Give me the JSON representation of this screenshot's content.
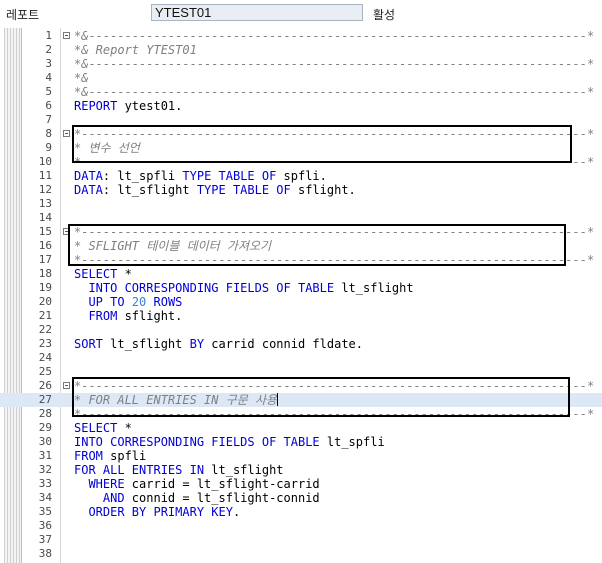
{
  "header": {
    "program_label": "레포트",
    "program_name": "YTEST01",
    "status": "활성"
  },
  "lines": [
    {
      "n": "1",
      "fold": true,
      "parts": [
        {
          "t": "*&---------------------------------------------------------------------*",
          "c": "cmt"
        }
      ]
    },
    {
      "n": "2",
      "fold": false,
      "parts": [
        {
          "t": "*& Report YTEST01",
          "c": "cmt"
        }
      ]
    },
    {
      "n": "3",
      "fold": false,
      "parts": [
        {
          "t": "*&---------------------------------------------------------------------*",
          "c": "cmt"
        }
      ]
    },
    {
      "n": "4",
      "fold": false,
      "parts": [
        {
          "t": "*&",
          "c": "cmt"
        }
      ]
    },
    {
      "n": "5",
      "fold": false,
      "parts": [
        {
          "t": "*&---------------------------------------------------------------------*",
          "c": "cmt"
        }
      ]
    },
    {
      "n": "6",
      "fold": false,
      "parts": [
        {
          "t": "REPORT",
          "c": "kw"
        },
        {
          "t": " ytest01.",
          "c": ""
        }
      ]
    },
    {
      "n": "7",
      "fold": false,
      "parts": []
    },
    {
      "n": "8",
      "fold": true,
      "parts": [
        {
          "t": "*----------------------------------------------------------------------*",
          "c": "cmt"
        }
      ]
    },
    {
      "n": "9",
      "fold": false,
      "parts": [
        {
          "t": "* 변수 선언",
          "c": "cmt"
        }
      ]
    },
    {
      "n": "10",
      "fold": false,
      "parts": [
        {
          "t": "*----------------------------------------------------------------------*",
          "c": "cmt"
        }
      ]
    },
    {
      "n": "11",
      "fold": false,
      "parts": [
        {
          "t": "DATA",
          "c": "kw"
        },
        {
          "t": ": lt_spfli ",
          "c": ""
        },
        {
          "t": "TYPE TABLE OF",
          "c": "kw"
        },
        {
          "t": " spfli.",
          "c": ""
        }
      ]
    },
    {
      "n": "12",
      "fold": false,
      "parts": [
        {
          "t": "DATA",
          "c": "kw"
        },
        {
          "t": ": lt_sflight ",
          "c": ""
        },
        {
          "t": "TYPE TABLE OF",
          "c": "kw"
        },
        {
          "t": " sflight.",
          "c": ""
        }
      ]
    },
    {
      "n": "13",
      "fold": false,
      "parts": []
    },
    {
      "n": "14",
      "fold": false,
      "parts": []
    },
    {
      "n": "15",
      "fold": true,
      "parts": [
        {
          "t": "*----------------------------------------------------------------------*",
          "c": "cmt"
        }
      ]
    },
    {
      "n": "16",
      "fold": false,
      "parts": [
        {
          "t": "* SFLIGHT 테이블 데이터 가져오기",
          "c": "cmt"
        }
      ]
    },
    {
      "n": "17",
      "fold": false,
      "parts": [
        {
          "t": "*----------------------------------------------------------------------*",
          "c": "cmt"
        }
      ]
    },
    {
      "n": "18",
      "fold": false,
      "parts": [
        {
          "t": "SELECT",
          "c": "kw"
        },
        {
          "t": " *",
          "c": ""
        }
      ]
    },
    {
      "n": "19",
      "fold": false,
      "parts": [
        {
          "t": "  INTO CORRESPONDING FIELDS OF TABLE",
          "c": "kw"
        },
        {
          "t": " lt_sflight",
          "c": ""
        }
      ]
    },
    {
      "n": "20",
      "fold": false,
      "parts": [
        {
          "t": "  UP TO",
          "c": "kw"
        },
        {
          "t": " ",
          "c": ""
        },
        {
          "t": "20",
          "c": "num"
        },
        {
          "t": " ",
          "c": ""
        },
        {
          "t": "ROWS",
          "c": "kw"
        }
      ]
    },
    {
      "n": "21",
      "fold": false,
      "parts": [
        {
          "t": "  FROM",
          "c": "kw"
        },
        {
          "t": " sflight.",
          "c": ""
        }
      ]
    },
    {
      "n": "22",
      "fold": false,
      "parts": []
    },
    {
      "n": "23",
      "fold": false,
      "parts": [
        {
          "t": "SORT",
          "c": "kw"
        },
        {
          "t": " lt_sflight ",
          "c": ""
        },
        {
          "t": "BY",
          "c": "kw"
        },
        {
          "t": " carrid connid fldate.",
          "c": ""
        }
      ]
    },
    {
      "n": "24",
      "fold": false,
      "parts": []
    },
    {
      "n": "25",
      "fold": false,
      "parts": []
    },
    {
      "n": "26",
      "fold": true,
      "parts": [
        {
          "t": "*----------------------------------------------------------------------*",
          "c": "cmt"
        }
      ]
    },
    {
      "n": "27",
      "fold": false,
      "hl": true,
      "caret": true,
      "parts": [
        {
          "t": "* FOR ALL ENTRIES IN 구문 사용",
          "c": "cmt"
        }
      ]
    },
    {
      "n": "28",
      "fold": false,
      "parts": [
        {
          "t": "*----------------------------------------------------------------------*",
          "c": "cmt"
        }
      ]
    },
    {
      "n": "29",
      "fold": false,
      "parts": [
        {
          "t": "SELECT",
          "c": "kw"
        },
        {
          "t": " *",
          "c": ""
        }
      ]
    },
    {
      "n": "30",
      "fold": false,
      "parts": [
        {
          "t": "INTO CORRESPONDING FIELDS OF TABLE",
          "c": "kw"
        },
        {
          "t": " lt_spfli",
          "c": ""
        }
      ]
    },
    {
      "n": "31",
      "fold": false,
      "parts": [
        {
          "t": "FROM",
          "c": "kw"
        },
        {
          "t": " spfli",
          "c": ""
        }
      ]
    },
    {
      "n": "32",
      "fold": false,
      "parts": [
        {
          "t": "FOR ALL ENTRIES IN",
          "c": "kw"
        },
        {
          "t": " lt_sflight",
          "c": ""
        }
      ]
    },
    {
      "n": "33",
      "fold": false,
      "parts": [
        {
          "t": "  WHERE",
          "c": "kw"
        },
        {
          "t": " carrid = lt_sflight-carrid",
          "c": ""
        }
      ]
    },
    {
      "n": "34",
      "fold": false,
      "parts": [
        {
          "t": "    AND",
          "c": "kw"
        },
        {
          "t": " connid = lt_sflight-connid",
          "c": ""
        }
      ]
    },
    {
      "n": "35",
      "fold": false,
      "parts": [
        {
          "t": "  ORDER BY PRIMARY KEY",
          "c": "kw"
        },
        {
          "t": ".",
          "c": ""
        }
      ]
    },
    {
      "n": "36",
      "fold": false,
      "parts": []
    },
    {
      "n": "37",
      "fold": false,
      "parts": []
    },
    {
      "n": "38",
      "fold": false,
      "parts": []
    }
  ]
}
